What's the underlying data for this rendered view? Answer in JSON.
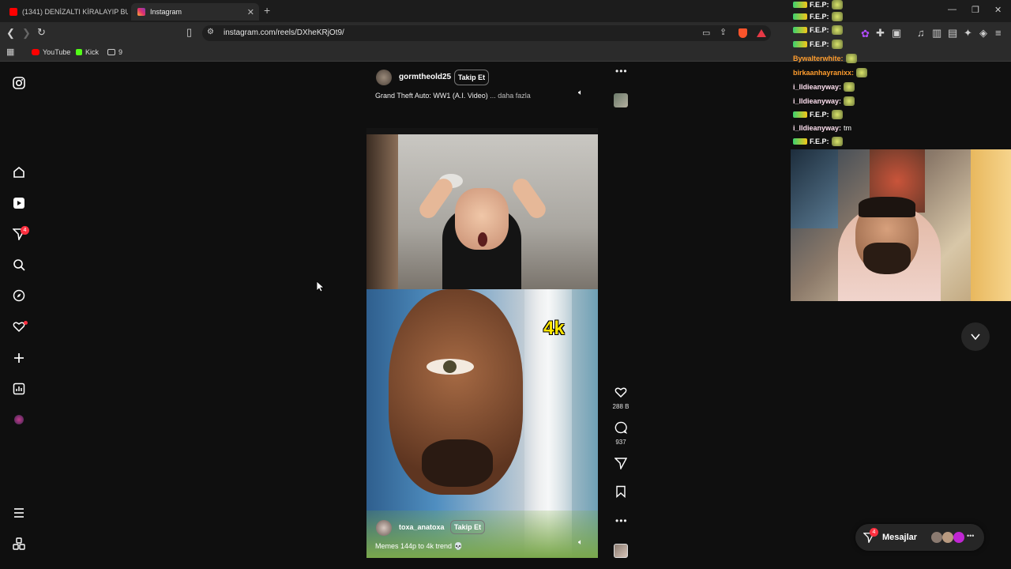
{
  "browser": {
    "tabs": [
      {
        "title": "(1341) DENİZALTI KİRALAYIP BUZULL",
        "active": false,
        "color": "#ff0000"
      },
      {
        "title": "Instagram",
        "active": true,
        "color": "#e1306c"
      }
    ],
    "url": "instagram.com/reels/DXheKRjOt9/",
    "bookmarks": [
      {
        "label": "YouTube",
        "color": "#ff0000"
      },
      {
        "label": "Kick",
        "color": "#53fc18"
      },
      {
        "label": "9",
        "color": "#cccccc"
      }
    ]
  },
  "sidebar": {
    "notifications_badge": "4"
  },
  "previous_reel": {
    "username": "gormtheold25",
    "follow_label": "Takip Et",
    "caption": "Grand Theft Auto: WW1 (A.I. Video)",
    "more_label": "... daha fazla"
  },
  "current_reel": {
    "overlay_text": "4k",
    "username": "toxa_anatoxa",
    "follow_label": "Takip Et",
    "caption": "Memes 144p to 4k trend 💀",
    "likes": "288 B",
    "comments": "937"
  },
  "messages": {
    "label": "Mesajlar",
    "badge": "4"
  },
  "chat_overlay": [
    {
      "user": "F.E.P:",
      "color": "#ffffff"
    },
    {
      "user": "F.E.P:",
      "color": "#ffffff"
    },
    {
      "user": "F.E.P:",
      "color": "#ffffff"
    },
    {
      "user": "F.E.P:",
      "color": "#ffffff"
    },
    {
      "user": "Bywalterwhite:",
      "color": "#ff9d2e"
    },
    {
      "user": "birkaanhayranixx:",
      "color": "#ff9d2e"
    },
    {
      "user": "i_lldieanyway:",
      "color": "#ffe0f0"
    },
    {
      "user": "i_lldieanyway:",
      "color": "#ffe0f0"
    },
    {
      "user": "F.E.P:",
      "color": "#ffffff"
    },
    {
      "user": "i_lldieanyway:",
      "color": "#ffe0f0",
      "text": "tm"
    },
    {
      "user": "F.E.P:",
      "color": "#ffffff"
    }
  ]
}
